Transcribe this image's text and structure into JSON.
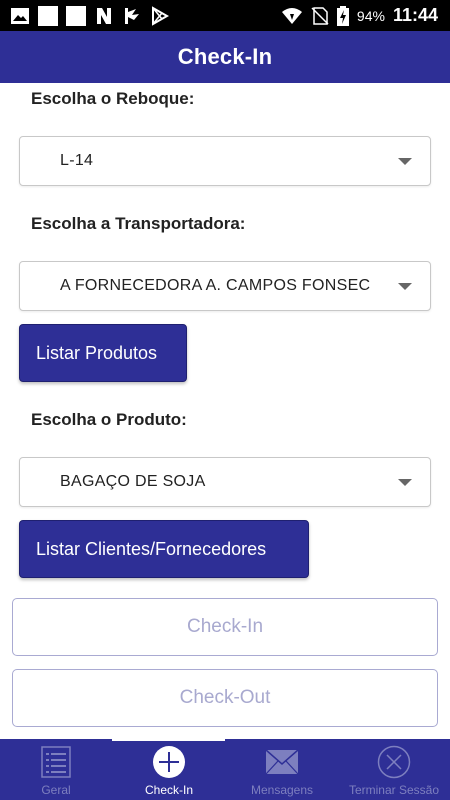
{
  "status_bar": {
    "battery": "94%",
    "time": "11:44",
    "icons": [
      "image-icon",
      "white-square-icon",
      "white-square-icon",
      "n-icon",
      "flag-icon",
      "play-store-icon",
      "wifi-icon",
      "no-sim-icon",
      "battery-charging-icon"
    ]
  },
  "app_bar": {
    "title": "Check-In"
  },
  "form": {
    "reboque_label": "Escolha o Reboque:",
    "reboque_value": "L-14",
    "transportadora_label": "Escolha a Transportadora:",
    "transportadora_value": "A FORNECEDORA A. CAMPOS FONSEC",
    "listar_produtos": "Listar Produtos",
    "produto_label": "Escolha o Produto:",
    "produto_value": "BAGAÇO DE SOJA",
    "listar_clientes": "Listar Clientes/Fornecedores",
    "checkin": "Check-In",
    "checkout": "Check-Out"
  },
  "tabs": [
    {
      "label": "Geral",
      "icon": "list-icon"
    },
    {
      "label": "Check-In",
      "icon": "plus-circle-icon",
      "active": true
    },
    {
      "label": "Mensagens",
      "icon": "envelope-icon"
    },
    {
      "label": "Terminar Sessão",
      "icon": "close-circle-icon"
    }
  ],
  "colors": {
    "primary": "#2e2f96",
    "disabled_text": "#a8a9cf",
    "tab_inactive": "#7d7fbf"
  }
}
